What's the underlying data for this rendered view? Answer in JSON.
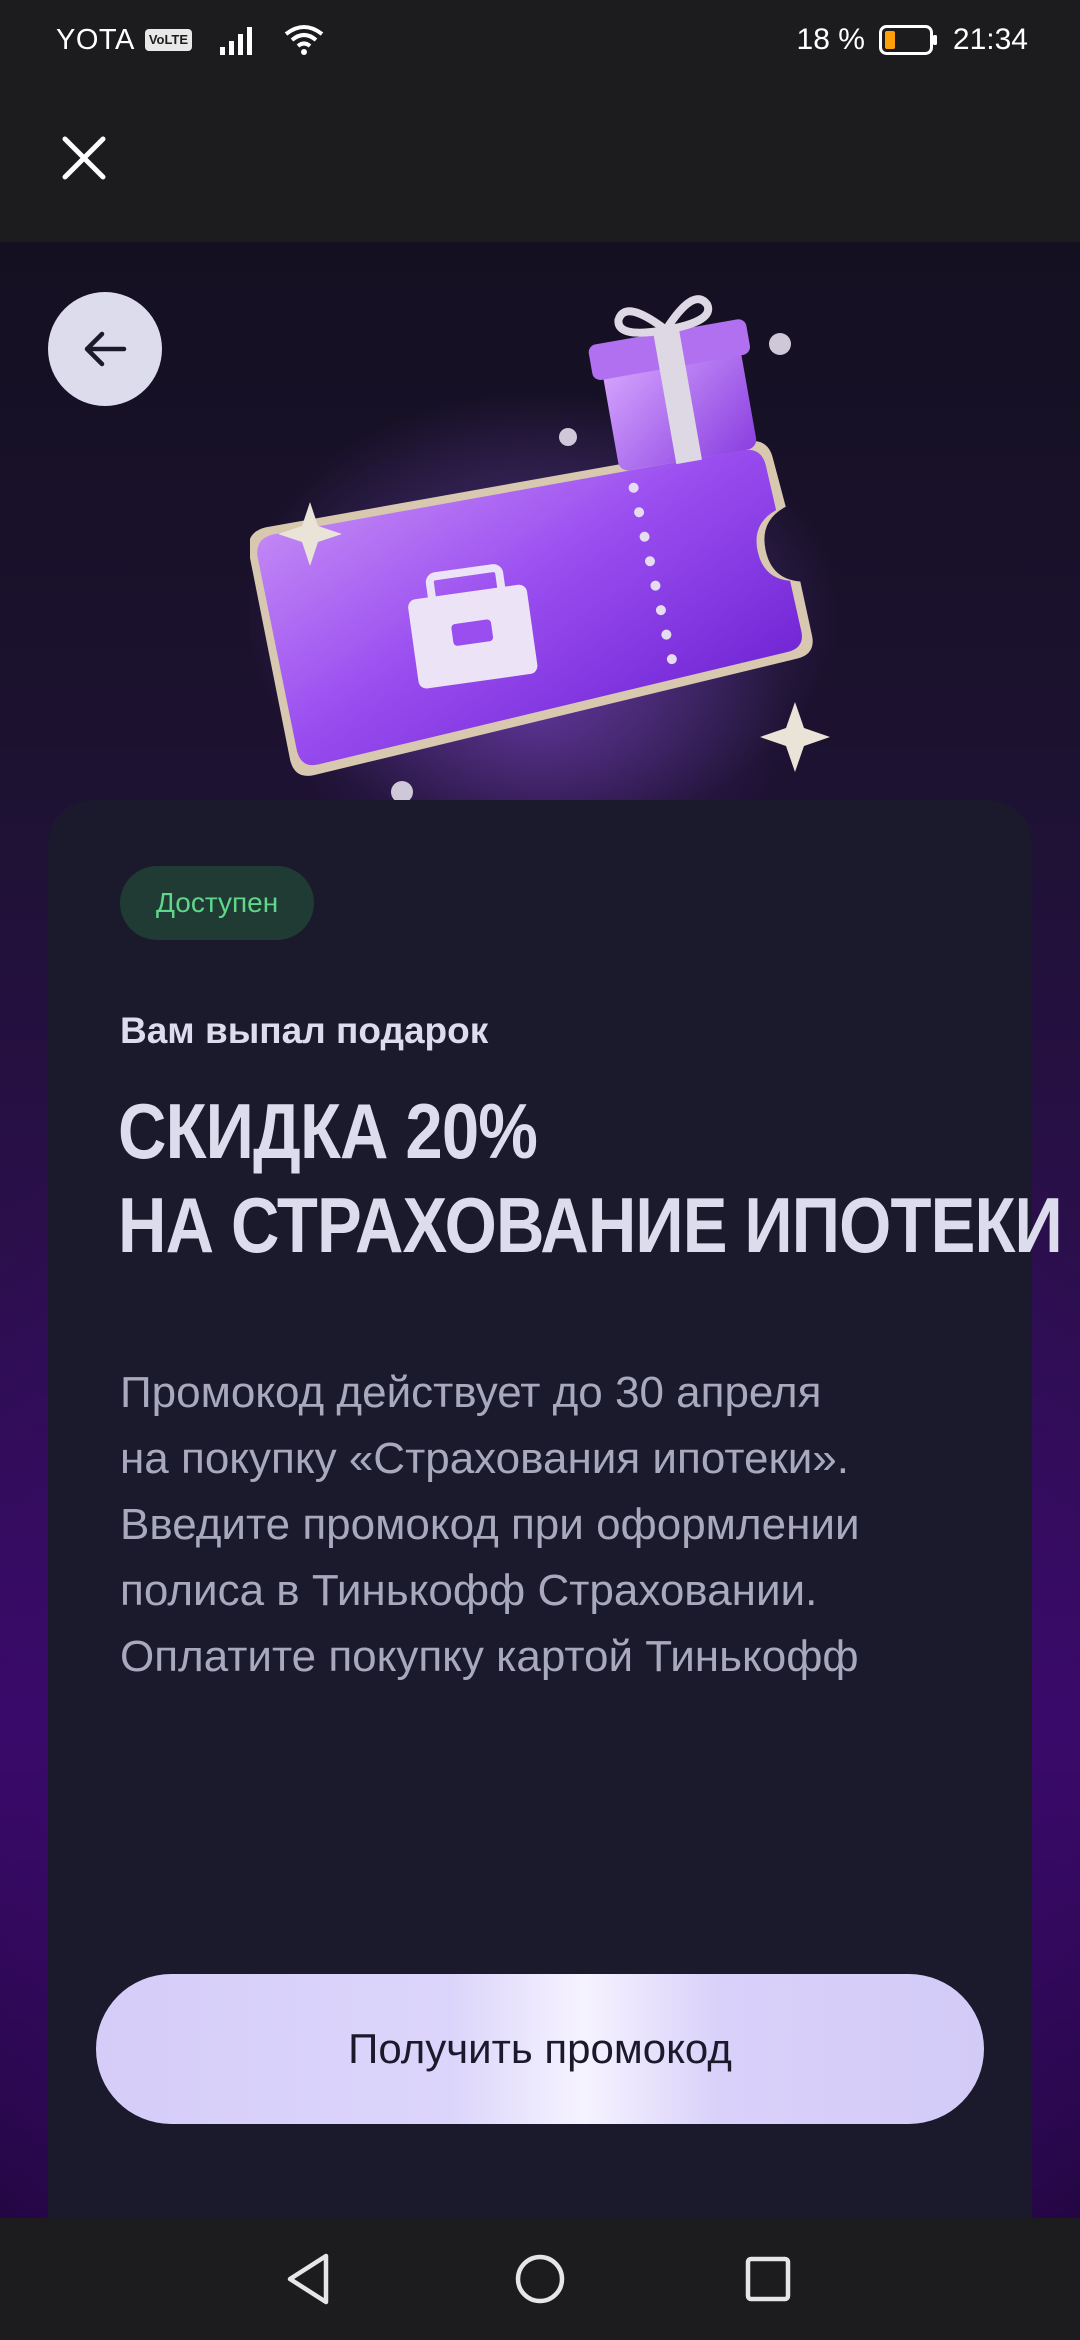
{
  "status_bar": {
    "carrier": "YOTA",
    "volte": "VoLTE",
    "battery_percent": "18 %",
    "time": "21:34"
  },
  "header": {
    "close_icon": "close-icon"
  },
  "hero": {
    "back_icon": "arrow-left-icon",
    "illustration": "gift-ticket-illustration"
  },
  "card": {
    "badge": "Доступен",
    "subtitle": "Вам выпал подарок",
    "headline_lines": [
      "СКИДКА 20%",
      "НА СТРАХОВАНИЕ ИПОТЕКИ"
    ],
    "description_lines": [
      "Промокод действует до 30 апреля",
      "на покупку «Страхования ипотеки».",
      "Введите промокод при оформлении",
      "полиса в Тинькофф Страховании.",
      "Оплатите покупку картой Тинькофф"
    ],
    "cta_label": "Получить промокод"
  },
  "colors": {
    "badge_text": "#5fd68a",
    "badge_bg": "#1f3b33",
    "card_bg": "#1a1a2c",
    "accent_purple": "#8a2be2"
  },
  "nav_bar": {
    "back": "nav-back-icon",
    "home": "nav-home-icon",
    "recents": "nav-recents-icon"
  }
}
